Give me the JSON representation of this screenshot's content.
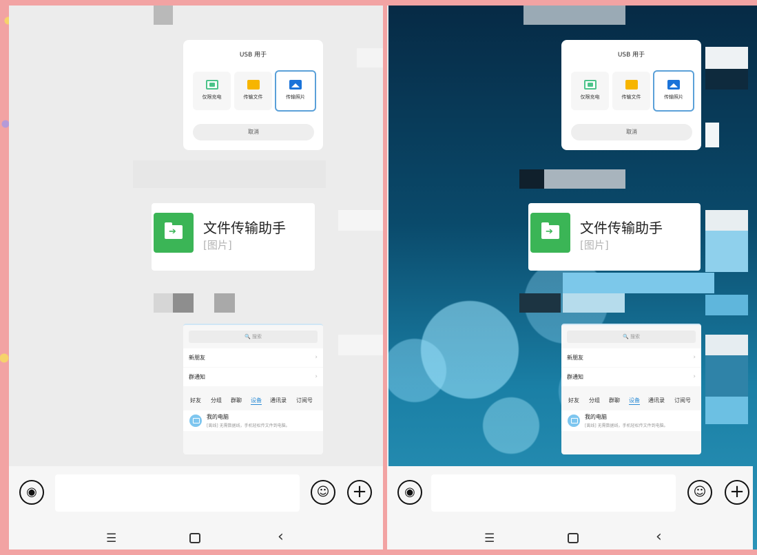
{
  "usb_dialog": {
    "title": "USB 用于",
    "options": [
      {
        "label": "仅限充电",
        "icon": "battery-charge-icon",
        "color": "#4cc38a",
        "selected": false
      },
      {
        "label": "传输文件",
        "icon": "folder-icon",
        "color": "#f7b500",
        "selected": false
      },
      {
        "label": "传输照片",
        "icon": "photo-icon",
        "color": "#1a73d9",
        "selected": true
      }
    ],
    "cancel_label": "取消"
  },
  "chat": {
    "title": "文件传输助手",
    "subtitle": "[图片]",
    "icon": "file-transfer-folder-icon",
    "accent": "#3bb556"
  },
  "contacts": {
    "search_placeholder": "🔍 搜索",
    "rows": [
      "新朋友",
      "群通知"
    ],
    "tabs": [
      "好友",
      "分组",
      "群聊",
      "设备",
      "通讯录",
      "订阅号"
    ],
    "active_tab": "设备",
    "device": {
      "title": "我的电脑",
      "desc": "[离线] 无需数据线，手机轻松传文件到电脑。"
    }
  },
  "input_bar": {
    "voice_icon": "voice-icon",
    "emoji_icon": "emoji-icon",
    "plus_icon": "plus-icon"
  },
  "nav": {
    "menu_glyph": "☰",
    "back_glyph": "‹"
  },
  "colors": {
    "accent_blue": "#2a8bd5",
    "left_background": "#ececec",
    "frame": "#f2a3a3"
  }
}
